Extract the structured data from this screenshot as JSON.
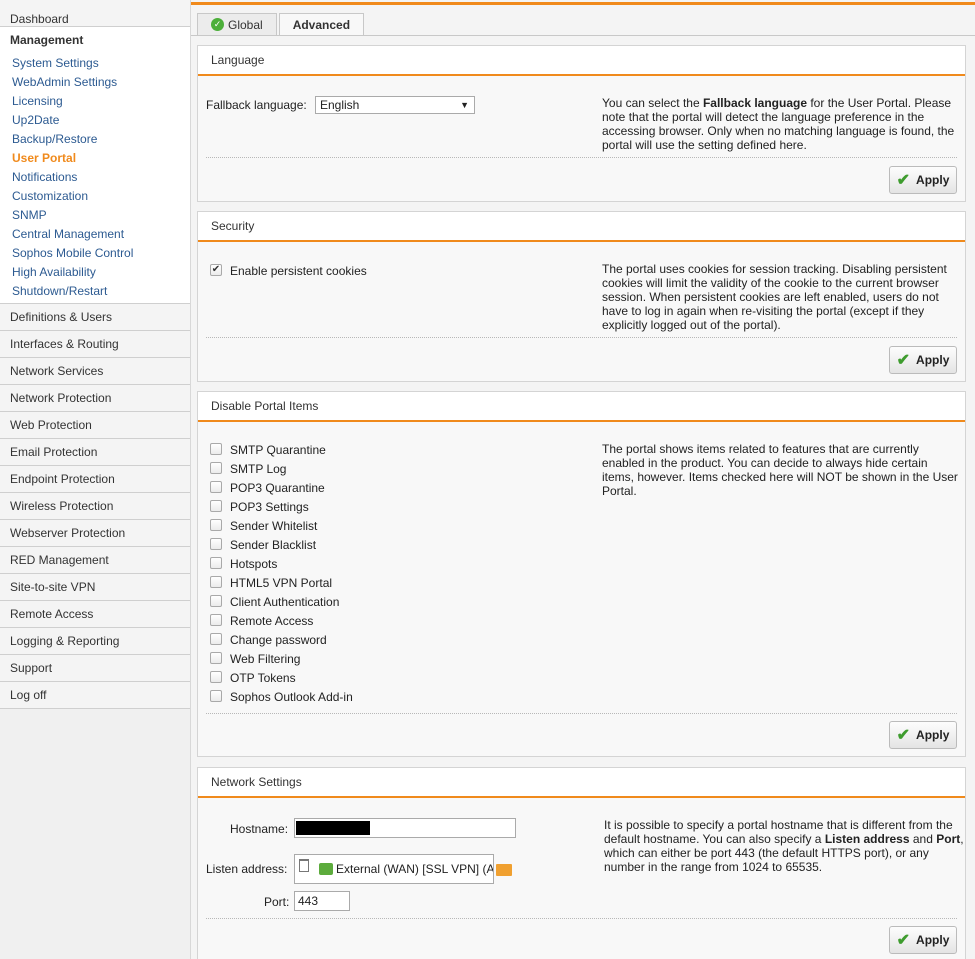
{
  "sidebar": {
    "dashboard": "Dashboard",
    "management": {
      "title": "Management",
      "items": [
        "System Settings",
        "WebAdmin Settings",
        "Licensing",
        "Up2Date",
        "Backup/Restore",
        "User Portal",
        "Notifications",
        "Customization",
        "SNMP",
        "Central Management",
        "Sophos Mobile Control",
        "High Availability",
        "Shutdown/Restart"
      ],
      "active": "User Portal"
    },
    "sections": [
      "Definitions & Users",
      "Interfaces & Routing",
      "Network Services",
      "Network Protection",
      "Web Protection",
      "Email Protection",
      "Endpoint Protection",
      "Wireless Protection",
      "Webserver Protection",
      "RED Management",
      "Site-to-site VPN",
      "Remote Access",
      "Logging & Reporting",
      "Support",
      "Log off"
    ]
  },
  "tabs": [
    {
      "label": "Global",
      "icon": "check-circle-icon"
    },
    {
      "label": "Advanced",
      "active": true
    }
  ],
  "apply_label": "Apply",
  "language": {
    "title": "Language",
    "fallback_label": "Fallback language:",
    "fallback_value": "English",
    "help_pre": "You can select the ",
    "help_bold": "Fallback language",
    "help_post": " for the User Portal. Please note that the portal will detect the language preference in the accessing browser. Only when no matching language is found, the portal will use the setting defined here."
  },
  "security": {
    "title": "Security",
    "cookie_label": "Enable persistent cookies",
    "cookie_checked": true,
    "help": "The portal uses cookies for session tracking. Disabling persistent cookies will limit the validity of the cookie to the current browser session. When persistent cookies are left enabled, users do not have to log in again when re-visiting the portal (except if they explicitly logged out of the portal)."
  },
  "portal_items": {
    "title": "Disable Portal Items",
    "items": [
      "SMTP Quarantine",
      "SMTP Log",
      "POP3 Quarantine",
      "POP3 Settings",
      "Sender Whitelist",
      "Sender Blacklist",
      "Hotspots",
      "HTML5 VPN Portal",
      "Client Authentication",
      "Remote Access",
      "Change password",
      "Web Filtering",
      "OTP Tokens",
      "Sophos Outlook Add-in"
    ],
    "help": "The portal shows items related to features that are currently enabled in the product. You can decide to always hide certain items, however. Items checked here will NOT be shown in the User Portal."
  },
  "network": {
    "title": "Network Settings",
    "hostname_label": "Hostname:",
    "listen_label": "Listen address:",
    "listen_value": "External (WAN) [SSL VPN] (A",
    "port_label": "Port:",
    "port_value": "443",
    "help_1": "It is possible to specify a portal hostname that is different from the default hostname. You can also specify a ",
    "help_b1": "Listen address",
    "help_2": " and ",
    "help_b2": "Port",
    "help_3": ", which can either be port 443 (the default HTTPS port), or any number in the range from 1024 to 65535."
  },
  "colors": {
    "accent": "#f08a1c",
    "link": "#2c5a91",
    "apply_tick": "#3e9c2e"
  }
}
